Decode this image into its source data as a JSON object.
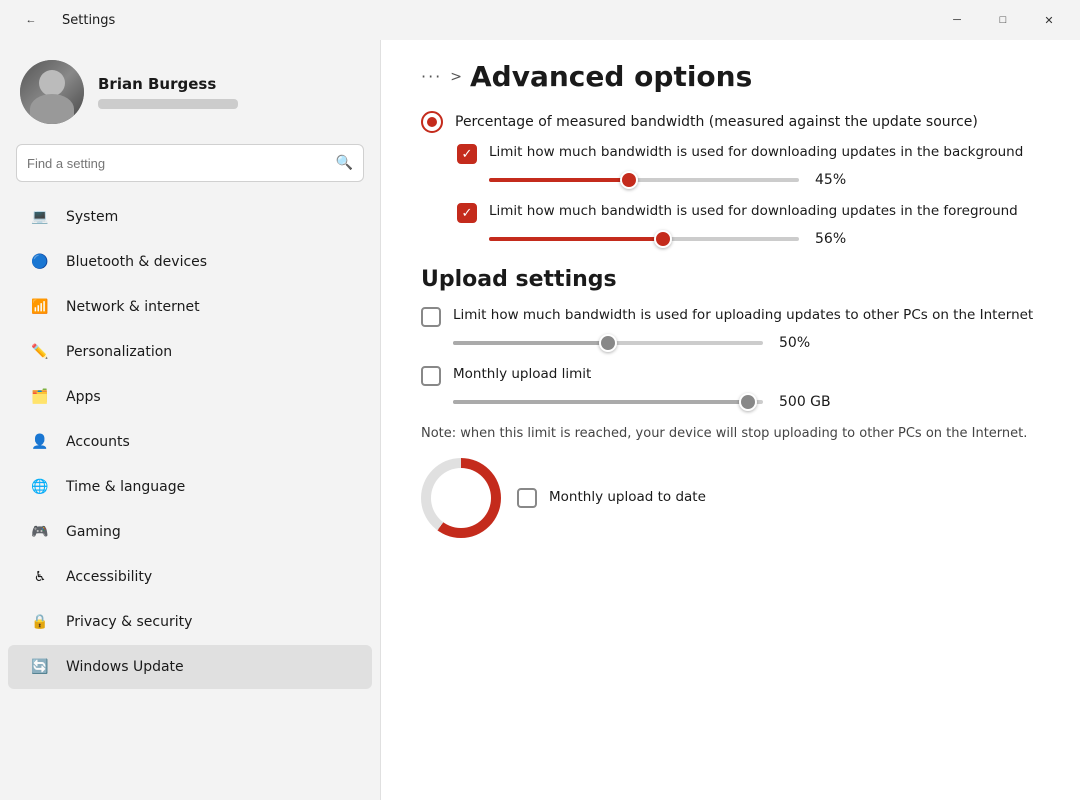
{
  "titlebar": {
    "title": "Settings",
    "back_icon": "←",
    "minimize_icon": "─",
    "maximize_icon": "□",
    "close_icon": "✕"
  },
  "sidebar": {
    "user": {
      "name": "Brian Burgess",
      "email_placeholder": "••••••••••••"
    },
    "search_placeholder": "Find a setting",
    "nav_items": [
      {
        "id": "system",
        "label": "System",
        "icon": "💻",
        "active": false
      },
      {
        "id": "bluetooth",
        "label": "Bluetooth & devices",
        "icon": "🔵",
        "active": false
      },
      {
        "id": "network",
        "label": "Network & internet",
        "icon": "📶",
        "active": false
      },
      {
        "id": "personalization",
        "label": "Personalization",
        "icon": "✏️",
        "active": false
      },
      {
        "id": "apps",
        "label": "Apps",
        "icon": "🗂️",
        "active": false
      },
      {
        "id": "accounts",
        "label": "Accounts",
        "icon": "👤",
        "active": false
      },
      {
        "id": "time",
        "label": "Time & language",
        "icon": "🌐",
        "active": false
      },
      {
        "id": "gaming",
        "label": "Gaming",
        "icon": "🎮",
        "active": false
      },
      {
        "id": "accessibility",
        "label": "Accessibility",
        "icon": "♿",
        "active": false
      },
      {
        "id": "privacy",
        "label": "Privacy & security",
        "icon": "🔒",
        "active": false
      },
      {
        "id": "windows-update",
        "label": "Windows Update",
        "icon": "🔄",
        "active": true
      }
    ]
  },
  "content": {
    "breadcrumb_dots": "···",
    "breadcrumb_separator": ">",
    "page_title": "Advanced options",
    "radio_label": "Percentage of measured bandwidth (measured against the update source)",
    "background_checkbox": {
      "label": "Limit how much bandwidth is used for downloading updates in the background",
      "checked": true
    },
    "background_slider": {
      "value_pct": 45,
      "value_label": "45%"
    },
    "foreground_checkbox": {
      "label": "Limit how much bandwidth is used for downloading updates in the foreground",
      "checked": true
    },
    "foreground_slider": {
      "value_pct": 56,
      "value_label": "56%"
    },
    "upload_section_title": "Upload settings",
    "upload_checkbox": {
      "label": "Limit how much bandwidth is used for uploading updates to other PCs on the Internet",
      "checked": false
    },
    "upload_slider": {
      "value_pct": 50,
      "value_label": "50%"
    },
    "monthly_limit_checkbox": {
      "label": "Monthly upload limit",
      "checked": false
    },
    "monthly_limit_slider": {
      "value_pct": 95,
      "value_label": "500 GB"
    },
    "note_text": "Note: when this limit is reached, your device will stop uploading to other PCs on the Internet.",
    "monthly_upload_label": "Monthly upload to date"
  }
}
